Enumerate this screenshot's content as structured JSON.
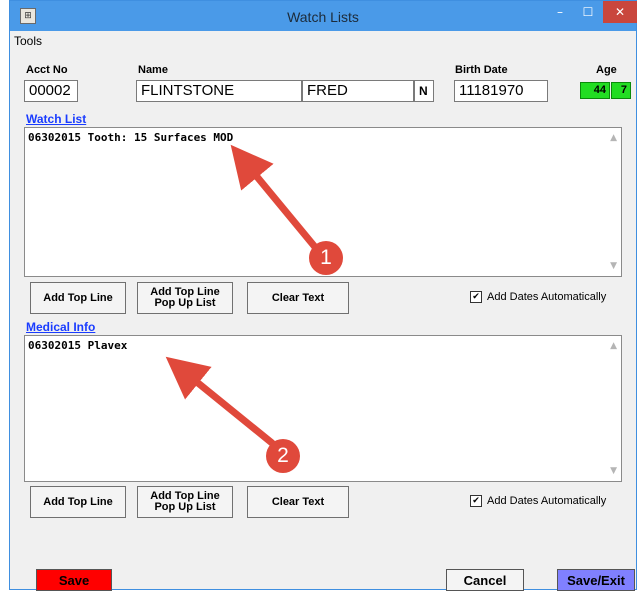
{
  "window": {
    "title": "Watch Lists",
    "minimize": "–",
    "maximize": "☐",
    "close": "✕",
    "app_icon": "⊞"
  },
  "menu": {
    "tools": "Tools"
  },
  "header": {
    "acct_label": "Acct No",
    "acct_value": "00002",
    "name_label": "Name",
    "last_name": "FLINTSTONE",
    "first_name": "FRED",
    "middle_initial": "N",
    "birth_label": "Birth Date",
    "birth_value": "11181970",
    "age_label": "Age",
    "age_years": "44",
    "age_months": "7"
  },
  "watch_list": {
    "title": "Watch List",
    "text": "06302015 Tooth: 15 Surfaces MOD",
    "add_top_line": "Add Top Line",
    "add_top_line_popup_1": "Add Top Line",
    "add_top_line_popup_2": "Pop Up List",
    "clear_text": "Clear Text",
    "add_dates_label": "Add Dates Automatically",
    "add_dates_checked": "✔"
  },
  "medical_info": {
    "title": "Medical Info",
    "text": "06302015 Plavex",
    "add_top_line": "Add Top Line",
    "add_top_line_popup_1": "Add Top Line",
    "add_top_line_popup_2": "Pop Up List",
    "clear_text": "Clear Text",
    "add_dates_label": "Add Dates Automatically",
    "add_dates_checked": "✔"
  },
  "footer": {
    "save": "Save",
    "cancel": "Cancel",
    "save_exit": "Save/Exit"
  },
  "annotations": {
    "badge_1": "1",
    "badge_2": "2"
  },
  "colors": {
    "titlebar": "#4a9ae8",
    "save_bg": "#ff0000",
    "save_exit_bg": "#8080ff",
    "age_bg": "#22dd22",
    "section_title": "#1a3cff",
    "annotation": "#e0493b"
  },
  "icons": {
    "scroll_up": "scroll-up-arrow-icon",
    "scroll_down": "scroll-down-arrow-icon",
    "checkbox": "checkbox-checked-icon"
  }
}
